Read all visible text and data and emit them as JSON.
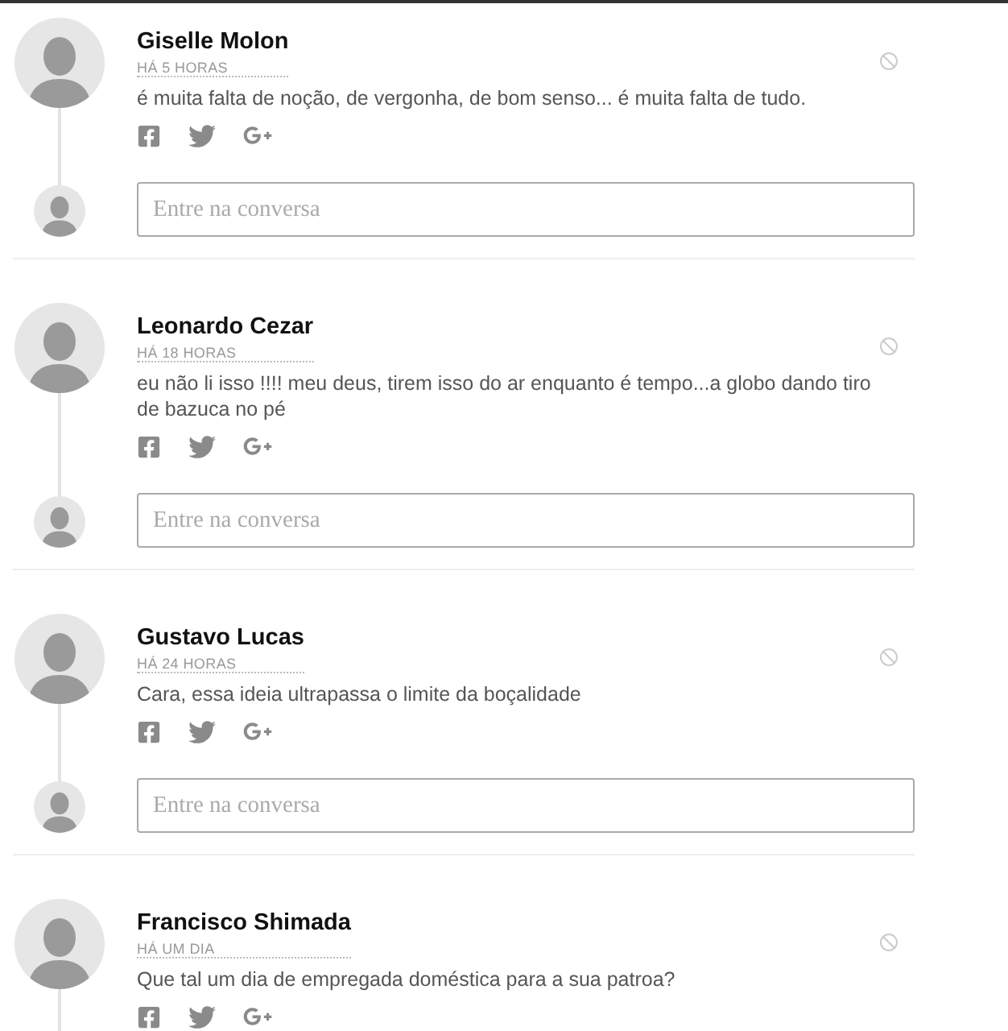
{
  "comments": [
    {
      "author": "Giselle Molon",
      "time": "HÁ 5 HORAS",
      "text": "é muita falta de noção, de vergonha, de bom senso... é muita falta de tudo.",
      "reply": {
        "placeholder": "Entre na conversa"
      }
    },
    {
      "author": "Leonardo Cezar",
      "time": "HÁ 18 HORAS",
      "text": "eu não li isso !!!! meu deus, tirem isso do ar enquanto é tempo...a globo dando tiro de bazuca no pé",
      "reply": {
        "placeholder": "Entre na conversa"
      }
    },
    {
      "author": "Gustavo Lucas",
      "time": "HÁ 24 HORAS",
      "text": "Cara, essa ideia ultrapassa o limite da boçalidade",
      "reply": {
        "placeholder": "Entre na conversa"
      }
    },
    {
      "author": "Francisco Shimada",
      "time": "HÁ UM DIA",
      "text": "Que tal um dia de empregada doméstica para a sua patroa?"
    }
  ]
}
